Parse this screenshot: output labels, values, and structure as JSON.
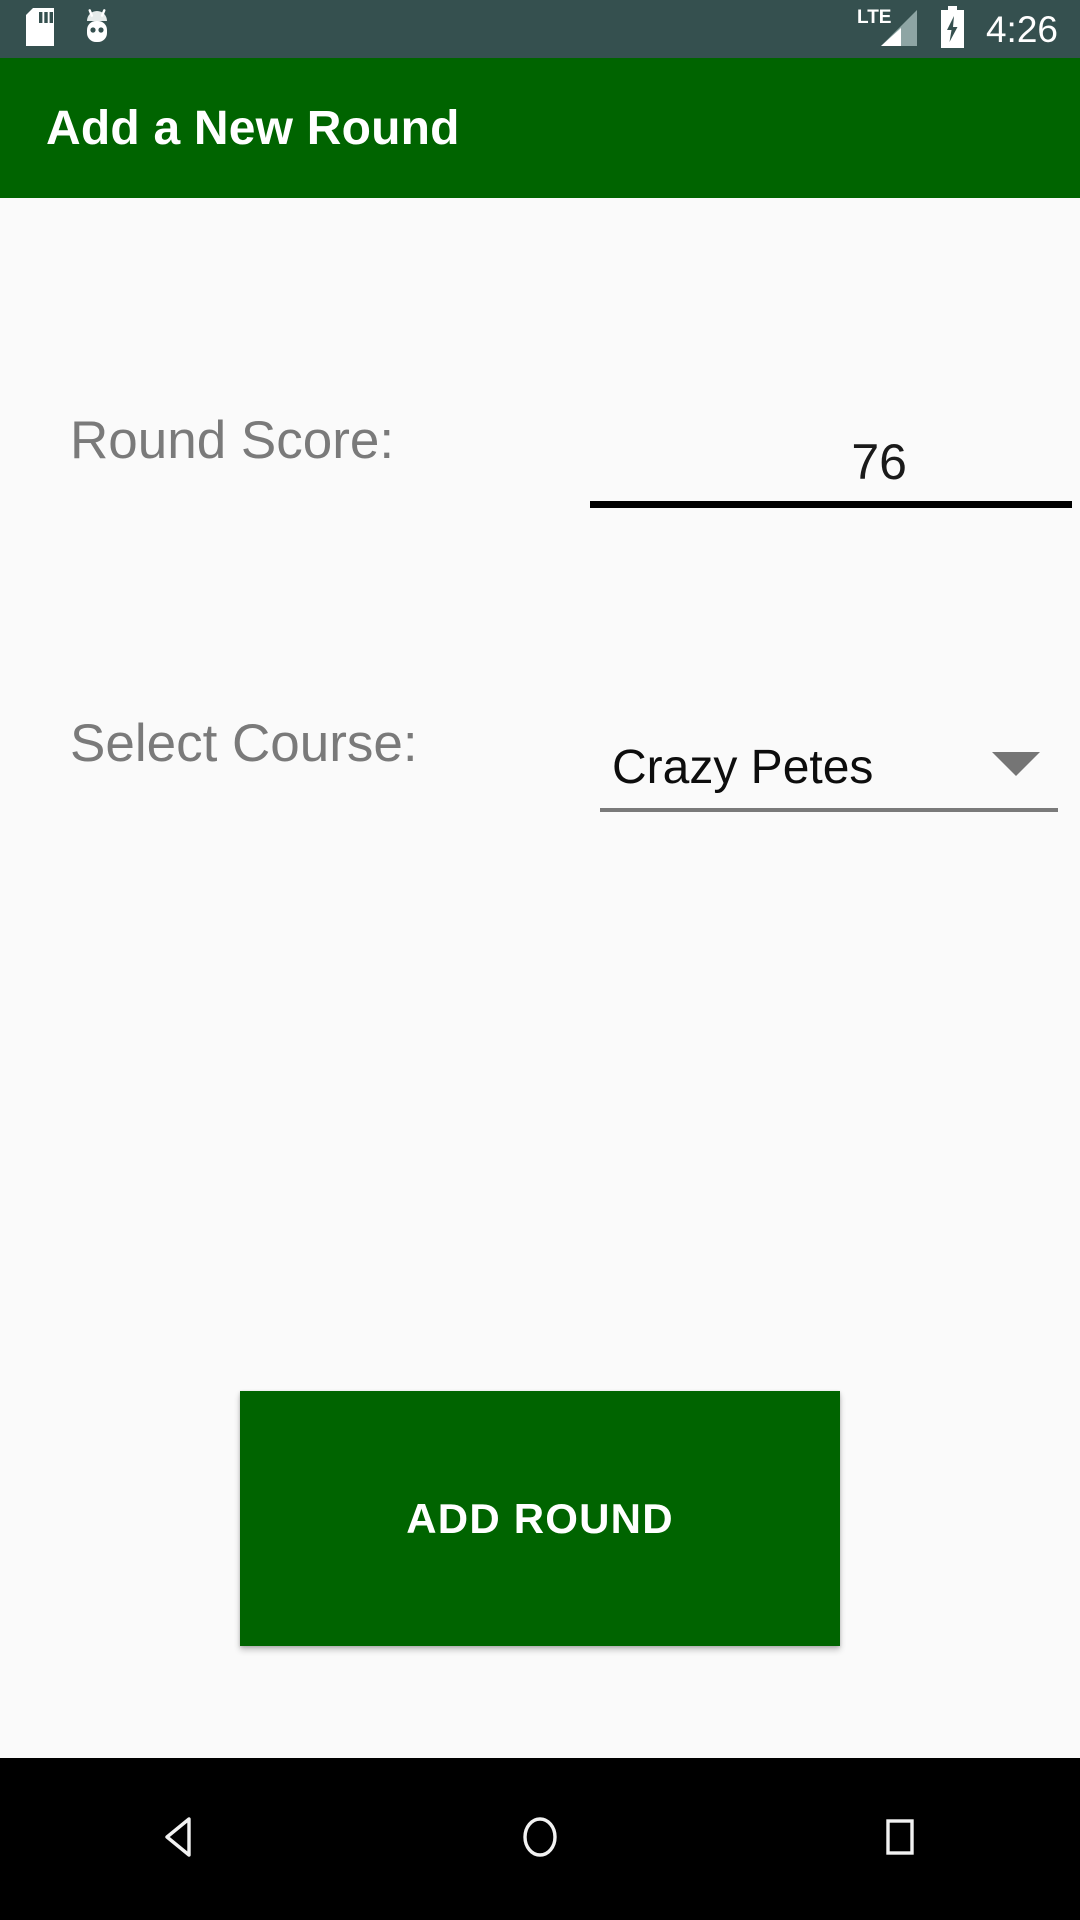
{
  "status_bar": {
    "background_color": "#35504F",
    "time": "4:26",
    "icons_left": [
      "sd-card-icon",
      "android-bugdroid-icon"
    ],
    "icons_right": [
      "lte-signal-icon",
      "battery-charging-icon"
    ],
    "network_label": "LTE"
  },
  "app_bar": {
    "title": "Add a New Round",
    "background_color": "#006400",
    "text_color": "#FFFFFF"
  },
  "form": {
    "score": {
      "label": "Round Score:",
      "value": "76",
      "placeholder": "",
      "underline_color": "#000000"
    },
    "course": {
      "label": "Select Course:",
      "selected": "Crazy Petes",
      "underline_color": "#7A7A7A",
      "caret_icon": "chevron-down-icon"
    }
  },
  "actions": {
    "add_round_label": "ADD ROUND",
    "add_round_color": "#006400"
  },
  "nav_bar": {
    "background_color": "#000000",
    "buttons": [
      {
        "name": "back-icon"
      },
      {
        "name": "home-icon"
      },
      {
        "name": "recents-icon"
      }
    ]
  }
}
